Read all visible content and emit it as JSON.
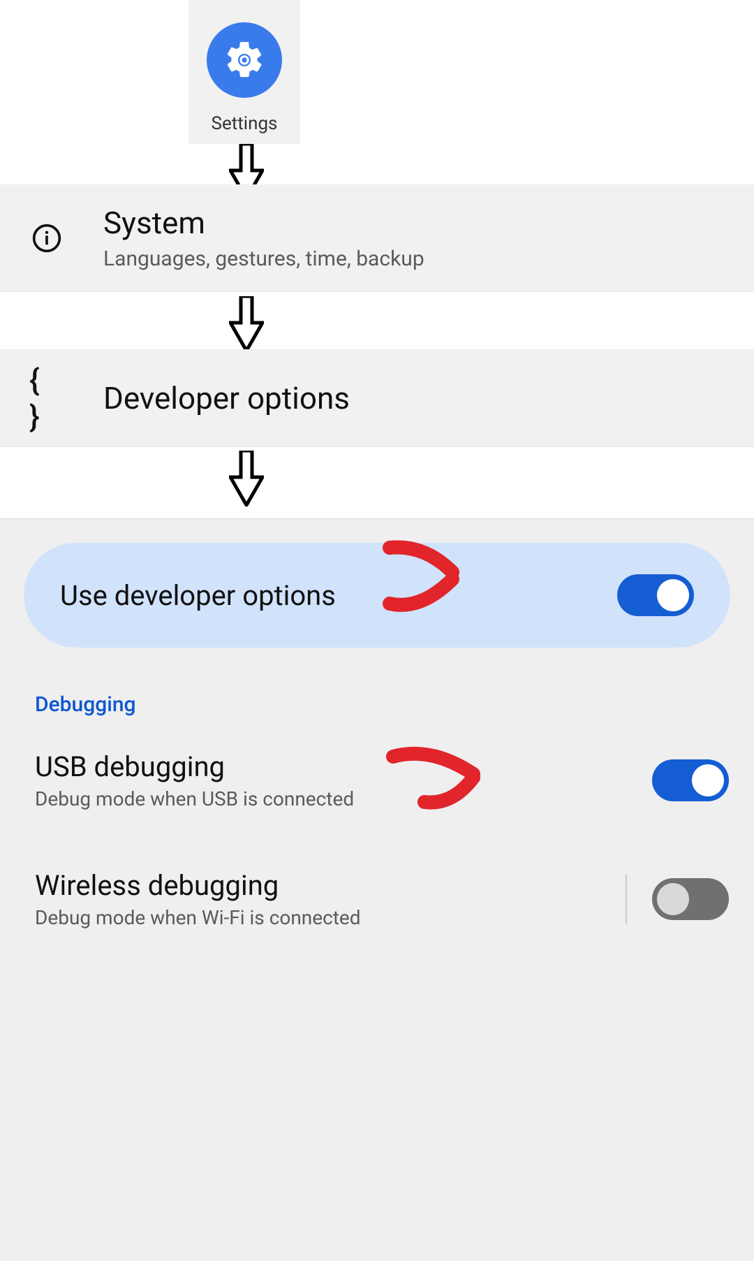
{
  "app": {
    "label": "Settings"
  },
  "system_row": {
    "title": "System",
    "subtitle": "Languages, gestures, time, backup"
  },
  "developer_row": {
    "title": "Developer options"
  },
  "dev_options_panel": {
    "master_toggle": {
      "label": "Use developer options",
      "on": true
    },
    "section_header": "Debugging",
    "usb_debugging": {
      "title": "USB debugging",
      "subtitle": "Debug mode when USB is connected",
      "on": true
    },
    "wireless_debugging": {
      "title": "Wireless debugging",
      "subtitle": "Debug mode when Wi-Fi is connected",
      "on": false
    }
  }
}
